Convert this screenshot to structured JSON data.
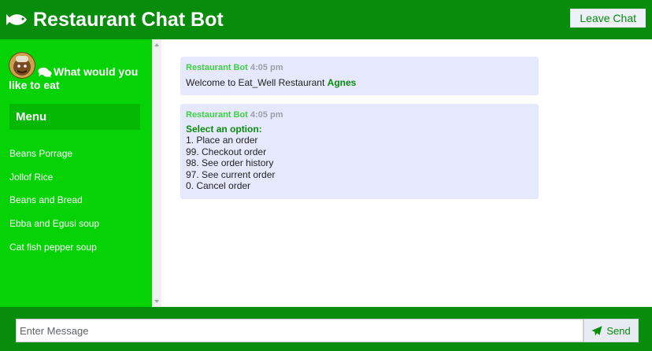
{
  "header": {
    "icon": "fish-icon",
    "title": "Restaurant Chat Bot",
    "leave_label": "Leave Chat"
  },
  "sidebar": {
    "avatar": "chef-avatar",
    "heading": "What would you like to eat",
    "menu_title": "Menu",
    "items": [
      {
        "label": "Beans Porrage"
      },
      {
        "label": "Jollof Rice"
      },
      {
        "label": "Beans and Bread"
      },
      {
        "label": "Ebba and Egusi soup"
      },
      {
        "label": "Cat fish pepper soup"
      }
    ]
  },
  "messages": [
    {
      "sender": "Restaurant Bot",
      "time": "4:05 pm",
      "text": "Welcome to Eat_Well Restaurant",
      "highlight": "Agnes"
    },
    {
      "sender": "Restaurant Bot",
      "time": "4:05 pm",
      "options_title": "Select an option:",
      "options": [
        "1. Place an order",
        "99. Checkout order",
        "98. See order history",
        "97. See current order",
        "0. Cancel order"
      ]
    }
  ],
  "composer": {
    "placeholder": "Enter Message",
    "send_label": "Send",
    "send_icon": "paper-plane-icon"
  },
  "colors": {
    "header": "#078c0b",
    "sidebar": "#05d305",
    "menu_box": "#04b804",
    "bubble": "#e6e9fc"
  }
}
